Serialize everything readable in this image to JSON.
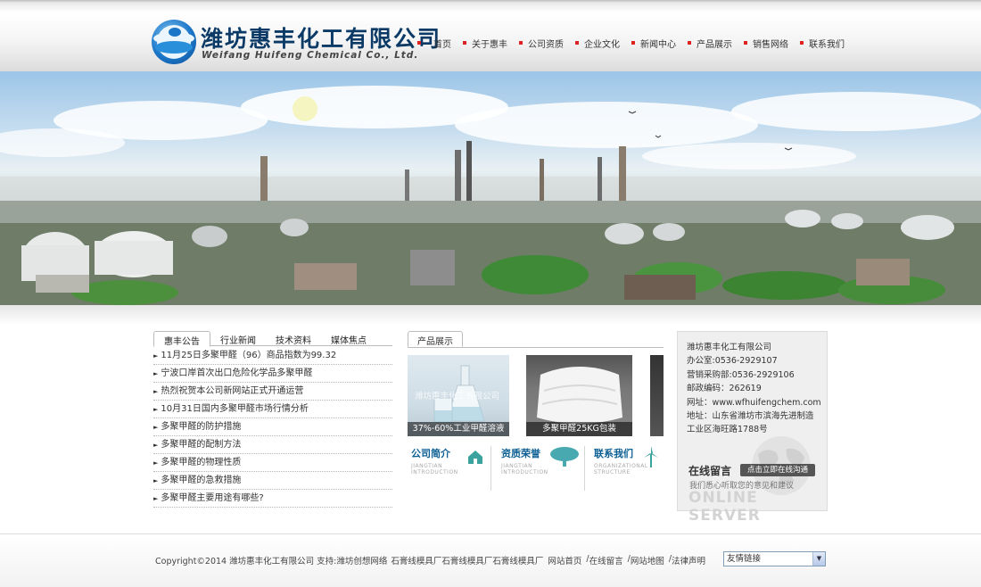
{
  "header": {
    "company_cn": "潍坊惠丰化工有限公司",
    "company_en": "Weifang Huifeng Chemical Co., Ltd."
  },
  "nav": [
    "首页",
    "关于惠丰",
    "公司资质",
    "企业文化",
    "新闻中心",
    "产品展示",
    "销售网络",
    "联系我们"
  ],
  "news": {
    "tabs": [
      "惠丰公告",
      "行业新闻",
      "技术资料",
      "媒体焦点"
    ],
    "items": [
      "11月25日多聚甲醛（96）商品指数为99.32",
      "宁波口岸首次出口危险化学品多聚甲醛",
      "热烈祝贺本公司新网站正式开通运营",
      "10月31日国内多聚甲醛市场行情分析",
      "多聚甲醛的防护措施",
      "多聚甲醛的配制方法",
      "多聚甲醛的物理性质",
      "多聚甲醛的急救措施",
      "多聚甲醛主要用途有哪些?"
    ]
  },
  "products": {
    "tab": "产品展示",
    "items": [
      {
        "caption": "37%-60%工业甲醛溶液",
        "watermark": "潍坊惠丰化工有限公司"
      },
      {
        "caption": "多聚甲醛25KG包装"
      }
    ]
  },
  "info_boxes": [
    {
      "title": "公司简介",
      "sub1": "JIANGTIAN",
      "sub2": "INTRODUCTION",
      "icon": "house-icon"
    },
    {
      "title": "资质荣誉",
      "sub1": "JIANGTIAN",
      "sub2": "INTRODUCTION",
      "icon": "tree-icon"
    },
    {
      "title": "联系我们",
      "sub1": "ORGANIZATIONAL",
      "sub2": "STRUCTURE",
      "icon": "windmill-icon"
    }
  ],
  "contact": {
    "company": "潍坊惠丰化工有限公司",
    "office": "办公室:0536-2929107",
    "sales": "营销采购部:0536-2929106",
    "postcode": "邮政编码：262619",
    "website": "网址：www.wfhuifengchem.com",
    "address1": "地址：山东省潍坊市滨海先进制造",
    "address2": "工业区海旺路1788号",
    "message_title": "在线留言",
    "message_button": "点击立即在线沟通",
    "message_sub": "我们悉心听取您的意见和建议",
    "online": "ONLINE SERVER"
  },
  "footer": {
    "copyright": "Copyright©2014 潍坊惠丰化工有限公司 支持:潍坊创想网络",
    "links": [
      "石膏线模具厂",
      "石膏线模具厂",
      "石膏线模具厂"
    ],
    "nav_links": [
      "网站首页",
      "在线留言",
      "网站地图",
      "法律声明"
    ],
    "separator": "/",
    "select_value": "友情链接"
  },
  "colors": {
    "nav_bullet": "#dd2222",
    "company_cn": "#0b3a66",
    "info_title": "#0b5f93"
  }
}
